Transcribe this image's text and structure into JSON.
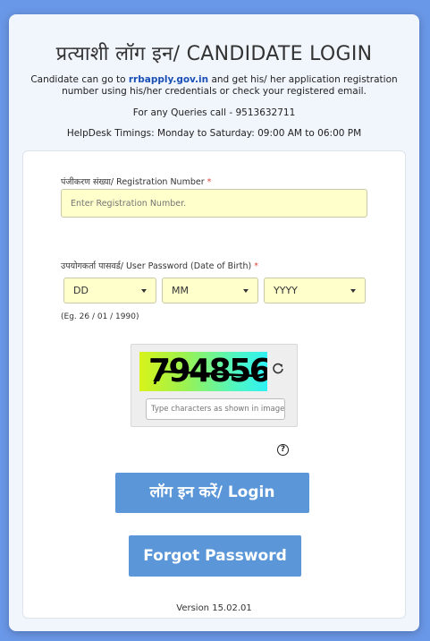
{
  "header": {
    "title": "प्रत्याशी लॉग इन/ CANDIDATE LOGIN",
    "intro_prefix": "Candidate can go to ",
    "intro_link": "rrbapply.gov.in",
    "intro_suffix": " and get his/ her application registration number using his/her credentials or check your registered email.",
    "queries": "For any Queries call - 9513632711",
    "helpdesk": "HelpDesk Timings: Monday to Saturday: 09:00 AM to 06:00 PM"
  },
  "form": {
    "registration_label": "पंजीकरण संख्या/ Registration Number",
    "registration_placeholder": "Enter Registration Number.",
    "password_label": "उपयोगकर्ता पासवर्ड/ User Password (Date of Birth)",
    "required_mark": "*",
    "day_value": "DD",
    "month_value": "MM",
    "year_value": "YYYY",
    "example": "(Eg. 26 / 01 / 1990)",
    "captcha_text": "794856",
    "captcha_placeholder": "Type characters as shown in image",
    "help_symbol": "?",
    "login_label": "लॉग इन करें/ Login",
    "forgot_label": "Forgot Password"
  },
  "footer": {
    "version": "Version 15.02.01"
  },
  "colors": {
    "background": "#6a98e8",
    "button": "#5b97d8",
    "input_bg": "#ffffcc",
    "link": "#1a4fb5",
    "required": "#e0453a"
  }
}
